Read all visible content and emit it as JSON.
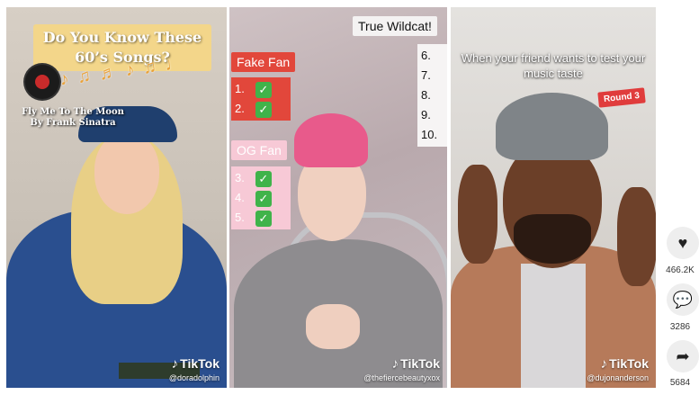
{
  "panels": [
    {
      "banner": "Do You Know These 60’s Songs?",
      "song_title": "Fly Me To The Moon",
      "song_artist": "By Frank Sinatra",
      "brand": "TikTok",
      "username": "@doradolphin"
    },
    {
      "true_wildcat": "True Wildcat!",
      "fake_fan": "Fake Fan",
      "og_fan": "OG Fan",
      "fake_numbers": [
        "1.",
        "2."
      ],
      "og_numbers": [
        "3.",
        "4.",
        "5."
      ],
      "wildcat_numbers": [
        "6.",
        "7.",
        "8.",
        "9.",
        "10."
      ],
      "check": "✓",
      "brand": "TikTok",
      "username": "@thefiercebeautyxox"
    },
    {
      "caption": "When your friend wants to test your music taste",
      "round": "Round 3",
      "brand": "TikTok",
      "username": "@dujonanderson"
    }
  ],
  "sidebar": {
    "likes": "466.2K",
    "comments": "3286",
    "shares": "5684"
  },
  "icons": [
    "heart-icon",
    "comment-icon",
    "share-icon",
    "tiktok-logo-icon"
  ],
  "colors": {
    "fake_fan": "#e2473b",
    "og_fan": "#f7c9d6",
    "check": "#40b34a",
    "round": "#e03c3c",
    "banner": "#f3d68a"
  }
}
